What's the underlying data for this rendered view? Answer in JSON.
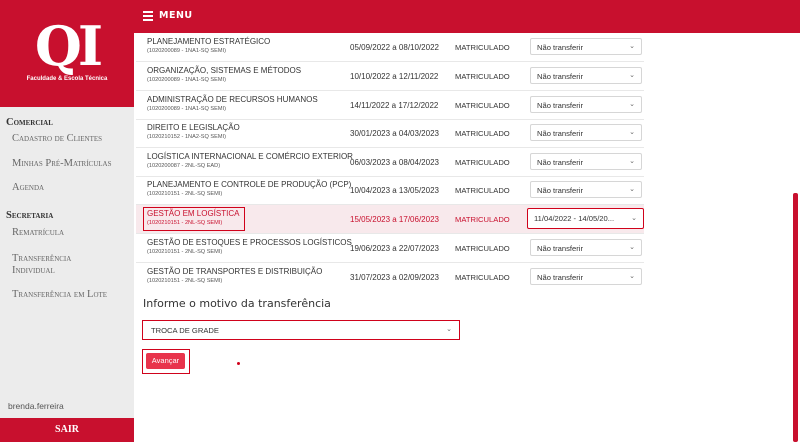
{
  "brand": {
    "logo_text": "QI",
    "tagline": "Faculdade & Escola Técnica",
    "color": "#c8102e"
  },
  "sidebar": {
    "sections": [
      {
        "title": "Comercial",
        "items": [
          "Cadastro de Clientes",
          "Minhas Pré-Matrículas",
          "Agenda"
        ]
      },
      {
        "title": "Secretaria",
        "items": [
          "Rematrícula",
          "Transferência Individual",
          "Transferência em Lote"
        ]
      }
    ],
    "user": "brenda.ferreira",
    "logout_label": "SAIR"
  },
  "topbar": {
    "menu_label": "MENU",
    "menu_icon": "hamburger-icon"
  },
  "courses": [
    {
      "name": "PLANEJAMENTO ESTRATÉGICO",
      "code": "(1020200089 - 1NA1-SQ SEMI)",
      "period": "05/09/2022 a 08/10/2022",
      "status": "MATRICULADO",
      "transfer": "Não transferir"
    },
    {
      "name": "ORGANIZAÇÃO, SISTEMAS E MÉTODOS",
      "code": "(1020200089 - 1NA1-SQ SEMI)",
      "period": "10/10/2022 a 12/11/2022",
      "status": "MATRICULADO",
      "transfer": "Não transferir"
    },
    {
      "name": "ADMINISTRAÇÃO DE RECURSOS HUMANOS",
      "code": "(1020200089 - 1NA1-SQ SEMI)",
      "period": "14/11/2022 a 17/12/2022",
      "status": "MATRICULADO",
      "transfer": "Não transferir"
    },
    {
      "name": "DIREITO E LEGISLAÇÃO",
      "code": "(1020210152 - 1NA2-SQ SEMI)",
      "period": "30/01/2023 a 04/03/2023",
      "status": "MATRICULADO",
      "transfer": "Não transferir"
    },
    {
      "name": "LOGÍSTICA INTERNACIONAL E COMÉRCIO EXTERIOR",
      "code": "(1020200087 - 2NL-SQ EAD)",
      "period": "06/03/2023 a 08/04/2023",
      "status": "MATRICULADO",
      "transfer": "Não transferir"
    },
    {
      "name": "PLANEJAMENTO E CONTROLE DE PRODUÇÃO (PCP)",
      "code": "(1020210151 - 2NL-SQ SEMI)",
      "period": "10/04/2023 a 13/05/2023",
      "status": "MATRICULADO",
      "transfer": "Não transferir"
    },
    {
      "name": "GESTÃO EM LOGÍSTICA",
      "code": "(1020210151 - 2NL-SQ SEMI)",
      "period": "15/05/2023 a 17/06/2023",
      "status": "MATRICULADO",
      "transfer": "11/04/2022 - 14/05/20..."
    },
    {
      "name": "GESTÃO DE ESTOQUES E PROCESSOS LOGÍSTICOS",
      "code": "(1020210151 - 2NL-SQ SEMI)",
      "period": "19/06/2023 a 22/07/2023",
      "status": "MATRICULADO",
      "transfer": "Não transferir"
    },
    {
      "name": "GESTÃO DE TRANSPORTES E DISTRIBUIÇÃO",
      "code": "(1020210151 - 2NL-SQ SEMI)",
      "period": "31/07/2023 a 02/09/2023",
      "status": "MATRICULADO",
      "transfer": "Não transferir"
    }
  ],
  "reason": {
    "title": "Informe o motivo da transferência",
    "selected": "TROCA DE GRADE"
  },
  "actions": {
    "next_label": "Avançar"
  },
  "colors": {
    "accent": "#c8102e",
    "highlight_row": "#f8e9ec",
    "annotation": "#d0021b",
    "button": "#e8344c"
  }
}
